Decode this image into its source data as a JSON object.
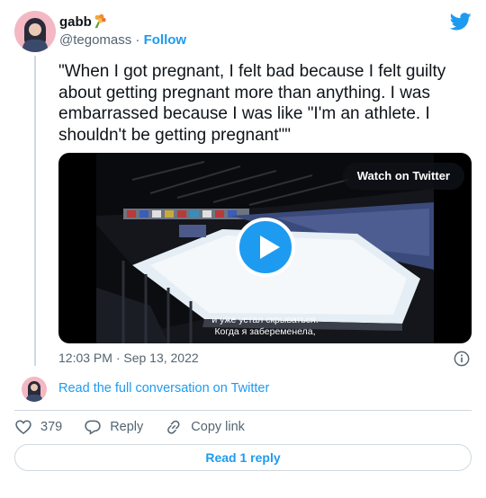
{
  "author": {
    "name": "gabb",
    "handle": "@tegomass",
    "separator": " · ",
    "follow_label": "Follow"
  },
  "tweet": {
    "text": "\"When I got pregnant, I felt bad because I felt guilty about getting pregnant more than anything. I was embarrassed because I was like \"I'm an athlete. I shouldn't be getting pregnant\"\"",
    "timestamp": "12:03 PM · Sep 13, 2022"
  },
  "media": {
    "watch_label": "Watch on Twitter",
    "subtitle_line1": "и уже устал скрываться.",
    "subtitle_line2": "Когда я забеременела,"
  },
  "conversation": {
    "link_label": "Read the full conversation on Twitter"
  },
  "actions": {
    "like_count": "379",
    "reply_label": "Reply",
    "copy_link_label": "Copy link"
  },
  "read_reply_label": "Read 1 reply",
  "colors": {
    "brand_blue": "#1d9bf0",
    "text": "#0f1419",
    "secondary": "#536471",
    "border": "#cfd9de"
  },
  "icons": [
    "twitter-bird-icon",
    "bouquet-emoji-icon",
    "play-icon",
    "info-icon",
    "heart-icon",
    "reply-bubble-icon",
    "link-icon"
  ]
}
